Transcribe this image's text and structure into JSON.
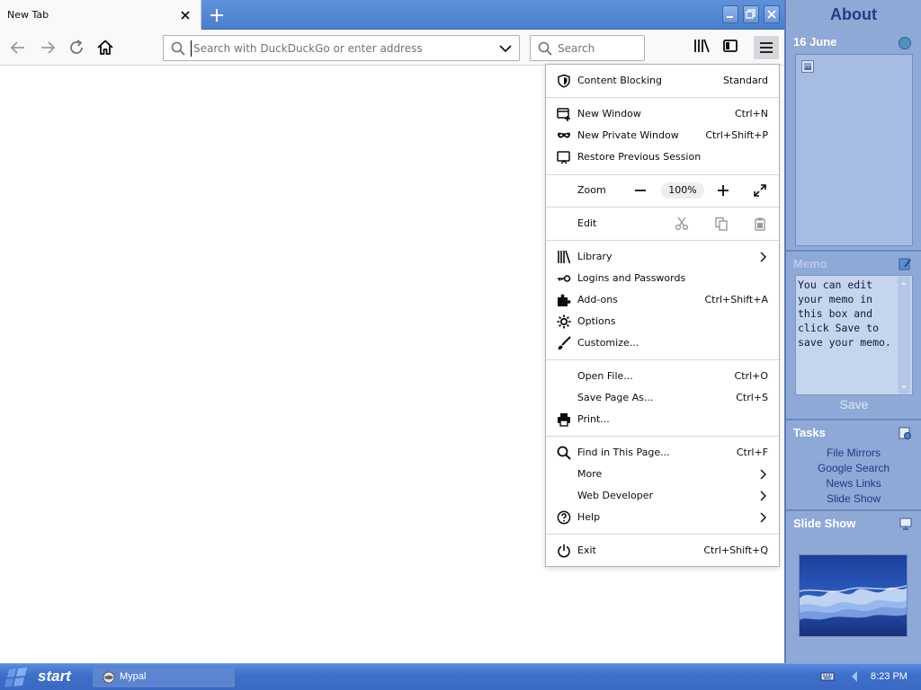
{
  "browser": {
    "tab_title": "New Tab",
    "url_placeholder": "Search with DuckDuckGo or enter address",
    "search_placeholder": "Search"
  },
  "menu": {
    "content_blocking": {
      "label": "Content Blocking",
      "value": "Standard"
    },
    "new_window": {
      "label": "New Window",
      "key": "Ctrl+N"
    },
    "new_private": {
      "label": "New Private Window",
      "key": "Ctrl+Shift+P"
    },
    "restore": {
      "label": "Restore Previous Session"
    },
    "zoom": {
      "label": "Zoom",
      "level": "100%"
    },
    "edit": {
      "label": "Edit"
    },
    "library": {
      "label": "Library"
    },
    "logins": {
      "label": "Logins and Passwords"
    },
    "addons": {
      "label": "Add-ons",
      "key": "Ctrl+Shift+A"
    },
    "options": {
      "label": "Options"
    },
    "customize": {
      "label": "Customize..."
    },
    "open_file": {
      "label": "Open File...",
      "key": "Ctrl+O"
    },
    "save_page": {
      "label": "Save Page As...",
      "key": "Ctrl+S"
    },
    "print": {
      "label": "Print..."
    },
    "find": {
      "label": "Find in This Page...",
      "key": "Ctrl+F"
    },
    "more": {
      "label": "More"
    },
    "web_dev": {
      "label": "Web Developer"
    },
    "help": {
      "label": "Help"
    },
    "exit": {
      "label": "Exit",
      "key": "Ctrl+Shift+Q"
    }
  },
  "sidebar": {
    "title": "About",
    "date": "16 June",
    "memo_title": "Memo",
    "memo_text": "You can edit your memo in this box and click Save to save your memo.",
    "save_label": "Save",
    "tasks_title": "Tasks",
    "tasks": [
      "File Mirrors",
      "Google Search",
      "News Links",
      "Slide Show"
    ],
    "slideshow_title": "Slide Show"
  },
  "taskbar": {
    "start_label": "start",
    "task_label": "Mypal",
    "clock": "8:23 PM"
  },
  "colors": {
    "tabbar": "#4a7fcc",
    "sidebar_bg": "#8fa9d6",
    "taskbar": "#3a69c3",
    "menu_border": "#b1b1b3"
  }
}
